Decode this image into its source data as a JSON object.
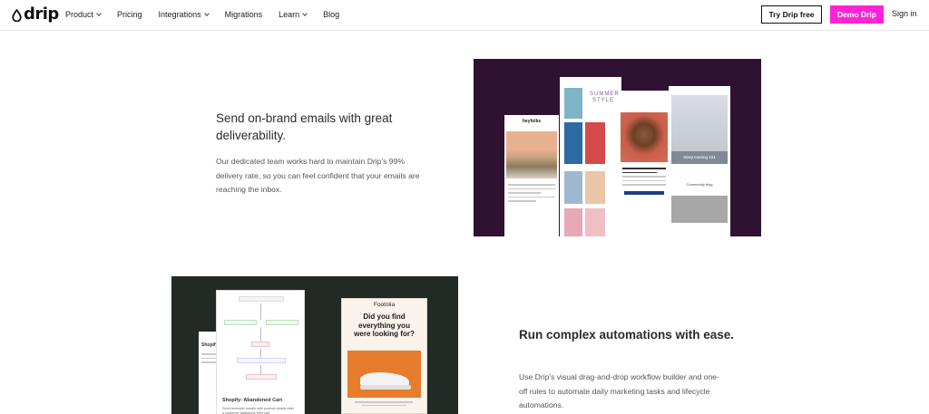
{
  "nav": {
    "logo_text": "drip",
    "links": [
      {
        "label": "Product",
        "has_dropdown": true
      },
      {
        "label": "Pricing",
        "has_dropdown": false
      },
      {
        "label": "Integrations",
        "has_dropdown": true
      },
      {
        "label": "Migrations",
        "has_dropdown": false
      },
      {
        "label": "Learn",
        "has_dropdown": true
      },
      {
        "label": "Blog",
        "has_dropdown": false
      }
    ],
    "try_button": "Try Drip free",
    "demo_button": "Demo Drip",
    "sign_in": "Sign in",
    "accent_color": "#ff22d6"
  },
  "section1": {
    "title": "Send on-brand emails with great deliverability.",
    "body": "Our dedicated team works hard to maintain Drip's 99% delivery rate, so you can feel confident that your emails are reaching the inbox.",
    "image": {
      "background_color": "#2f1131",
      "cards": {
        "heyfolks_brand": "heyfolks",
        "summer_label": "SUMMER STYLE",
        "sleep_label": "sleep training 101",
        "blog_label": "Community blog"
      }
    }
  },
  "section2": {
    "title": "Run complex automations with ease.",
    "body": "Use Drip's visual drag-and-drop workflow builder and one-off rules to automate daily marketing tasks and lifecycle automations.",
    "image": {
      "background_color": "#232a25",
      "workflow_card_title": "Shopify: Abandoned Cart",
      "workflow_card_desc": "Send reminder emails with product details after a customer abandons their cart.",
      "back_card_title": "Shopify: Br",
      "email_brand": "Footolia",
      "email_headline": "Did you find everything you were looking for?"
    }
  }
}
